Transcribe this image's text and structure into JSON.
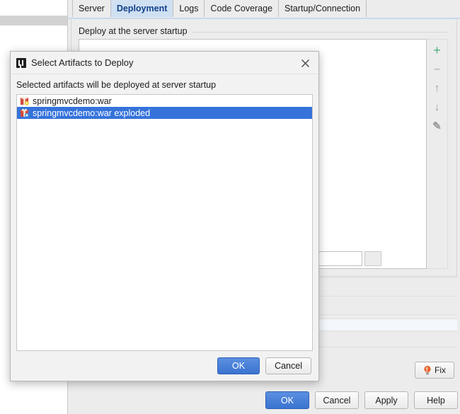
{
  "window": {
    "tabs": [
      {
        "label": "Server",
        "active": false
      },
      {
        "label": "Deployment",
        "active": true
      },
      {
        "label": "Logs",
        "active": false
      },
      {
        "label": "Code Coverage",
        "active": false
      },
      {
        "label": "Startup/Connection",
        "active": false
      }
    ],
    "deploy_section_title": "Deploy at the server startup",
    "side_toolbar": [
      {
        "name": "add-icon",
        "glyph": "+",
        "color": "#4caf7d"
      },
      {
        "name": "remove-icon",
        "glyph": "–",
        "color": "#b6b6b6"
      },
      {
        "name": "move-up-icon",
        "glyph": "↑",
        "color": "#9a9a9a"
      },
      {
        "name": "move-down-icon",
        "glyph": "↓",
        "color": "#9a9a9a"
      },
      {
        "name": "edit-pencil-icon",
        "glyph": "✎",
        "color": "#9a9a9a"
      }
    ],
    "fix_button": {
      "label": "Fix",
      "icon": "lightbulb-icon",
      "icon_color": "#e8622c"
    },
    "footer_buttons": [
      {
        "label": "OK",
        "primary": true
      },
      {
        "label": "Cancel",
        "primary": false
      },
      {
        "label": "Apply",
        "primary": false
      },
      {
        "label": "Help",
        "primary": false
      }
    ]
  },
  "dialog": {
    "title": "Select Artifacts to Deploy",
    "title_icon": "intellij-idea-icon",
    "close_icon": "close-icon",
    "instruction": "Selected artifacts will be deployed at server startup",
    "artifacts": [
      {
        "label": "springmvcdemo:war",
        "icon": "artifact-war-icon",
        "selected": false
      },
      {
        "label": "springmvcdemo:war exploded",
        "icon": "artifact-war-exploded-icon",
        "selected": true
      }
    ],
    "buttons": [
      {
        "label": "OK",
        "primary": true
      },
      {
        "label": "Cancel",
        "primary": false
      }
    ]
  },
  "colors": {
    "selection_blue": "#3573db",
    "primary_button": "#3a74d0",
    "active_tab": "#cfe0f2",
    "accent_green": "#4caf7d",
    "fix_orange": "#e8622c"
  }
}
